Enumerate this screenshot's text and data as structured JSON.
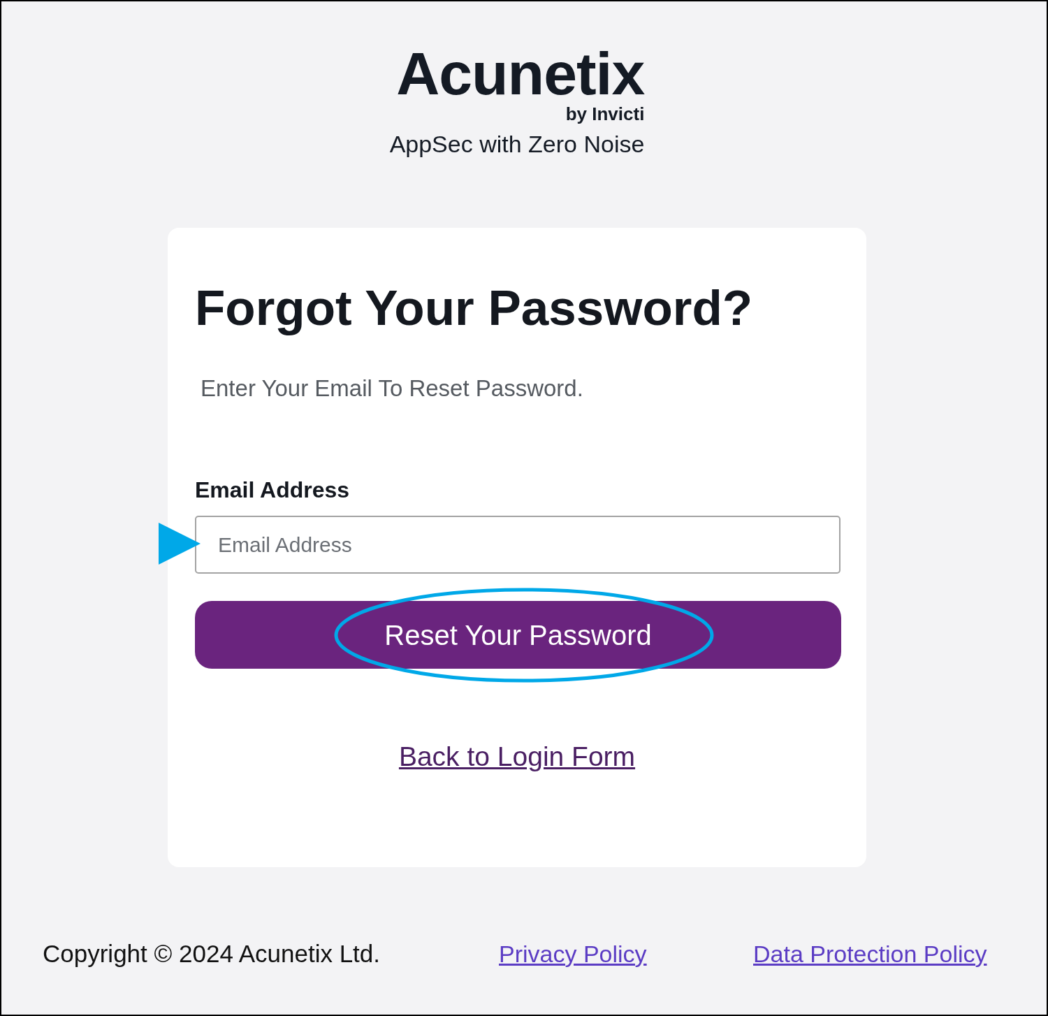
{
  "logo": {
    "wordmark": "Acunetix",
    "byline": "by Invicti"
  },
  "tagline": "AppSec with Zero Noise",
  "card": {
    "title": "Forgot Your Password?",
    "subtitle": "Enter Your Email To Reset Password.",
    "email_field": {
      "label": "Email Address",
      "placeholder": "Email Address",
      "annotation": {
        "kind": "arrow"
      }
    },
    "submit_button": {
      "label": "Reset Your Password",
      "annotation": {
        "kind": "ellipse"
      }
    },
    "back_link": "Back to Login Form"
  },
  "footer": {
    "copyright": "Copyright © 2024 Acunetix Ltd.",
    "links": [
      "Privacy Policy",
      "Data Protection Policy"
    ]
  }
}
